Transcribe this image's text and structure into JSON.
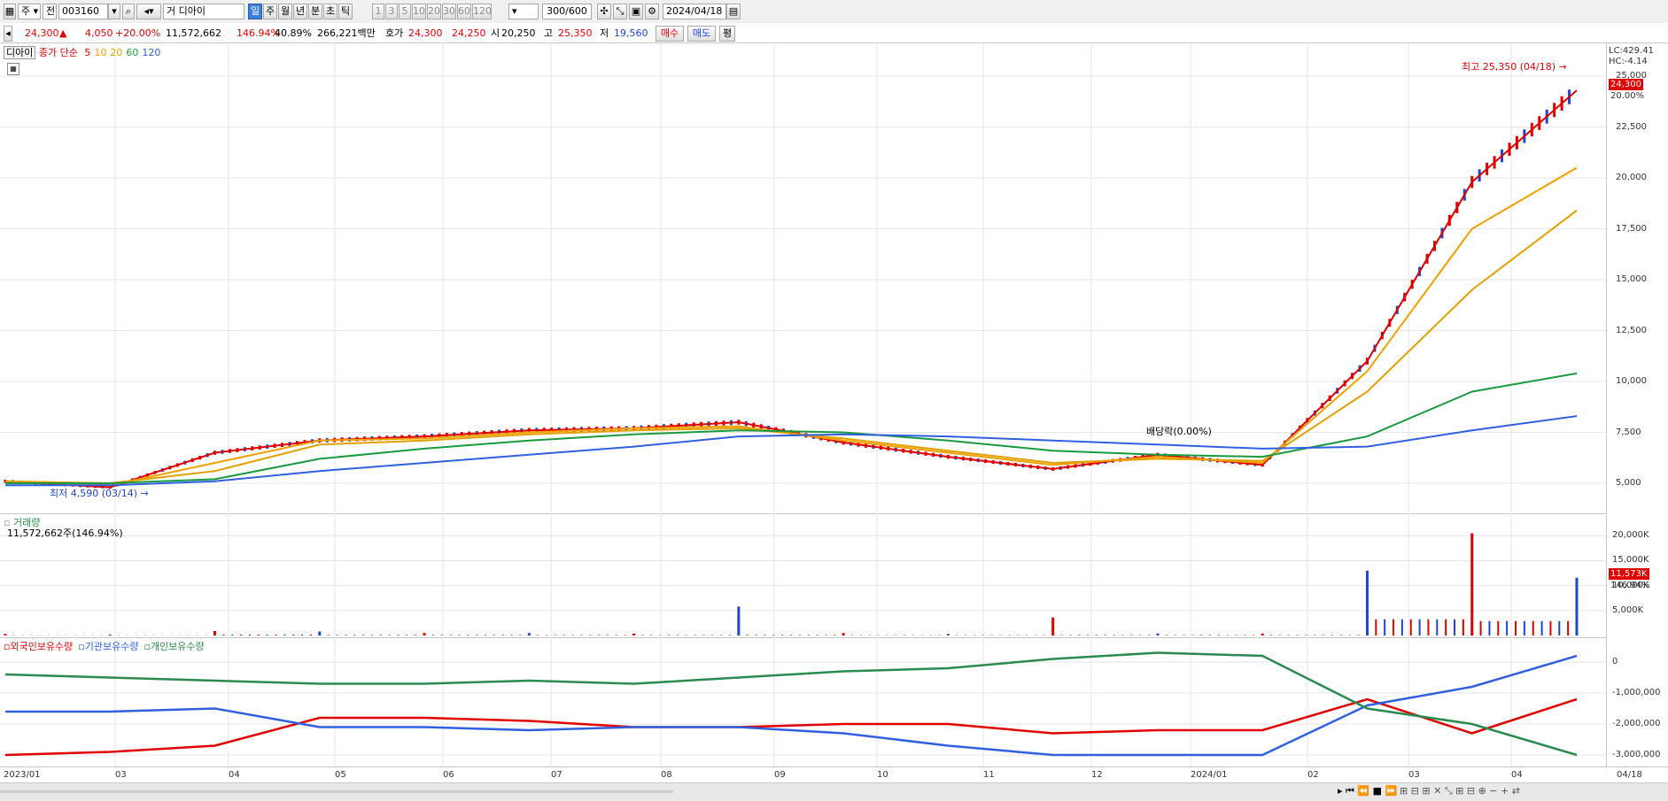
{
  "toolbar": {
    "market": "주",
    "code_type": "전",
    "code": "003160",
    "stock_name": "거 디아이",
    "periods": [
      "일",
      "주",
      "월",
      "년",
      "분",
      "초",
      "틱"
    ],
    "selected_period": "일",
    "numbers": [
      "1",
      "3",
      "5",
      "10",
      "20",
      "30",
      "60",
      "120"
    ],
    "count": "300",
    "count_total": "/600",
    "date": "2024/04/18"
  },
  "quote": {
    "price": "24,300",
    "arrow": "▲",
    "change": "4,050",
    "change_pct": "+20.00%",
    "volume": "11,572,662",
    "vol_ratio": "146.94%",
    "turnover": "40.89%",
    "amount": "266,221백만",
    "bid_label": "호가",
    "ask": "24,300",
    "bid": "24,250",
    "open_label": "시",
    "open": "20,250",
    "high_label": "고",
    "high": "25,350",
    "low_label": "저",
    "low": "19,560",
    "buy": "매수",
    "sell": "매도",
    "flat": "평"
  },
  "price_panel": {
    "name": "디아이",
    "ma_label": "종가 단순",
    "ma_periods": [
      "5",
      "10",
      "20",
      "60",
      "120"
    ],
    "ma_colors": [
      "#e00000",
      "#f0a000",
      "#e0a000",
      "#1a9a40",
      "#3060e0"
    ],
    "lc": "LC:429.41",
    "hc": "HC:-4.14",
    "yticks": [
      "25,000",
      "22,500",
      "20,000",
      "17,500",
      "15,000",
      "12,500",
      "10,000",
      "7,500",
      "5,000"
    ],
    "current_tag": "24,300",
    "pct_tag": "20.00%",
    "high_ann": "최고 25,350 (04/18)",
    "low_ann": "최저 4,590 (03/14)",
    "div_ann": "배당락(0.00%)"
  },
  "volume_panel": {
    "title": "거래량",
    "sub": "11,572,662주(146.94%)",
    "yticks": [
      "20,000K",
      "15,000K",
      "10,000K",
      "5,000K"
    ],
    "current_tag": "11,573K",
    "pct_tag": "146.94%"
  },
  "holding_panel": {
    "series": [
      "외국인보유수량",
      "기관보유수량",
      "개인보유수량"
    ],
    "colors": [
      "#e00000",
      "#3060e0",
      "#2a8a50"
    ],
    "yticks": [
      "0",
      "-1,000,000",
      "-2,000,000",
      "-3,000,000"
    ]
  },
  "xaxis": [
    "2023/01",
    "03",
    "04",
    "05",
    "06",
    "07",
    "08",
    "09",
    "10",
    "11",
    "12",
    "2024/01",
    "02",
    "03",
    "04",
    "04/18"
  ],
  "chart_data": {
    "type": "line",
    "x": [
      "2023/01",
      "2023/03",
      "2023/04",
      "2023/05",
      "2023/06",
      "2023/07",
      "2023/08",
      "2023/09",
      "2023/10",
      "2023/11",
      "2023/12",
      "2024/01",
      "2024/02",
      "2024/03",
      "2024/04",
      "2024/04/18"
    ],
    "series": [
      {
        "name": "5",
        "values": [
          5100,
          4800,
          6500,
          7100,
          7300,
          7600,
          7700,
          8000,
          7000,
          6300,
          5700,
          6400,
          5900,
          11000,
          19800,
          24300
        ]
      },
      {
        "name": "10",
        "values": [
          5100,
          4900,
          6000,
          7100,
          7200,
          7500,
          7700,
          7800,
          7100,
          6500,
          5900,
          6300,
          6000,
          10500,
          17500,
          20500
        ]
      },
      {
        "name": "20",
        "values": [
          5100,
          5000,
          5600,
          6900,
          7100,
          7400,
          7600,
          7700,
          7200,
          6600,
          6000,
          6200,
          6100,
          9500,
          14500,
          18400
        ]
      },
      {
        "name": "60",
        "values": [
          5000,
          5000,
          5200,
          6200,
          6700,
          7100,
          7400,
          7600,
          7500,
          7100,
          6600,
          6400,
          6300,
          7300,
          9500,
          10400
        ]
      },
      {
        "name": "120",
        "values": [
          4900,
          4900,
          5100,
          5600,
          6000,
          6400,
          6800,
          7300,
          7400,
          7300,
          7100,
          6900,
          6700,
          6800,
          7600,
          8300
        ]
      }
    ],
    "ylim": [
      4000,
      26000
    ],
    "volume_k": [
      300,
      200,
      900,
      800,
      500,
      500,
      400,
      5800,
      500,
      300,
      3600,
      400,
      400,
      13000,
      20500,
      11573
    ],
    "holdings": [
      {
        "name": "외국인보유수량",
        "values": [
          -3000000,
          -2900000,
          -2700000,
          -1800000,
          -1800000,
          -1900000,
          -2100000,
          -2100000,
          -2000000,
          -2000000,
          -2300000,
          -2200000,
          -2200000,
          -1200000,
          -2300000,
          -1200000
        ]
      },
      {
        "name": "기관보유수량",
        "values": [
          -1600000,
          -1600000,
          -1500000,
          -2100000,
          -2100000,
          -2200000,
          -2100000,
          -2100000,
          -2300000,
          -2700000,
          -3000000,
          -3000000,
          -3000000,
          -1400000,
          -800000,
          200000
        ]
      },
      {
        "name": "개인보유수량",
        "values": [
          -400000,
          -500000,
          -600000,
          -700000,
          -700000,
          -600000,
          -700000,
          -500000,
          -300000,
          -200000,
          100000,
          300000,
          200000,
          -1500000,
          -2000000,
          -3000000
        ]
      }
    ]
  }
}
